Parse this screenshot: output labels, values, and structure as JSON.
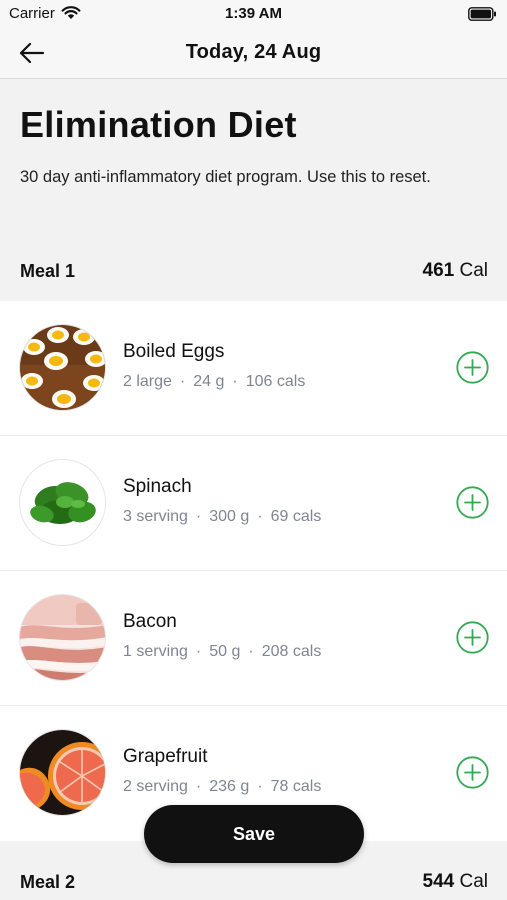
{
  "status_bar": {
    "carrier": "Carrier",
    "time": "1:39 AM"
  },
  "nav": {
    "title": "Today, 24 Aug",
    "back_icon": "arrow-left-icon"
  },
  "program": {
    "title": "Elimination Diet",
    "description": "30 day anti-inflammatory diet program. Use this to reset."
  },
  "meals": [
    {
      "name": "Meal 1",
      "calories_value": "461",
      "calories_unit": "Cal",
      "items": [
        {
          "name": "Boiled Eggs",
          "quantity": "2 large",
          "weight": "24 g",
          "calories": "106 cals",
          "image": "boiled-eggs"
        },
        {
          "name": "Spinach",
          "quantity": "3 serving",
          "weight": "300 g",
          "calories": "69 cals",
          "image": "spinach"
        },
        {
          "name": "Bacon",
          "quantity": "1 serving",
          "weight": "50 g",
          "calories": "208 cals",
          "image": "bacon"
        },
        {
          "name": "Grapefruit",
          "quantity": "2 serving",
          "weight": "236 g",
          "calories": "78 cals",
          "image": "grapefruit"
        }
      ]
    },
    {
      "name": "Meal 2",
      "calories_value": "544",
      "calories_unit": "Cal"
    }
  ],
  "actions": {
    "save_label": "Save"
  },
  "colors": {
    "accent_green": "#34a853",
    "button_dark": "#111111",
    "meta_gray": "#7f8691"
  }
}
